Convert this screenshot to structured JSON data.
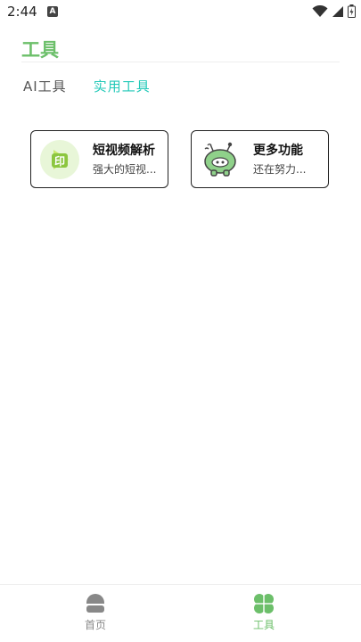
{
  "status_bar": {
    "time": "2:44",
    "notification_letter": "A",
    "icons": [
      "wifi-icon",
      "signal-icon",
      "battery-icon"
    ]
  },
  "header": {
    "title": "工具"
  },
  "tabs": [
    {
      "label": "AI工具",
      "active": false
    },
    {
      "label": "实用工具",
      "active": true
    }
  ],
  "cards": [
    {
      "title": "短视频解析",
      "description": "强大的短视...",
      "icon": "video-parse-icon"
    },
    {
      "title": "更多功能",
      "description": "还在努力...",
      "icon": "alien-mascot-icon"
    }
  ],
  "bottom_nav": [
    {
      "label": "首页",
      "icon": "home-icon",
      "active": false
    },
    {
      "label": "工具",
      "icon": "clover-icon",
      "active": true
    }
  ],
  "colors": {
    "accent_green": "#6cbf6a",
    "active_tab": "#23c9b8",
    "inactive_text": "#888888"
  }
}
